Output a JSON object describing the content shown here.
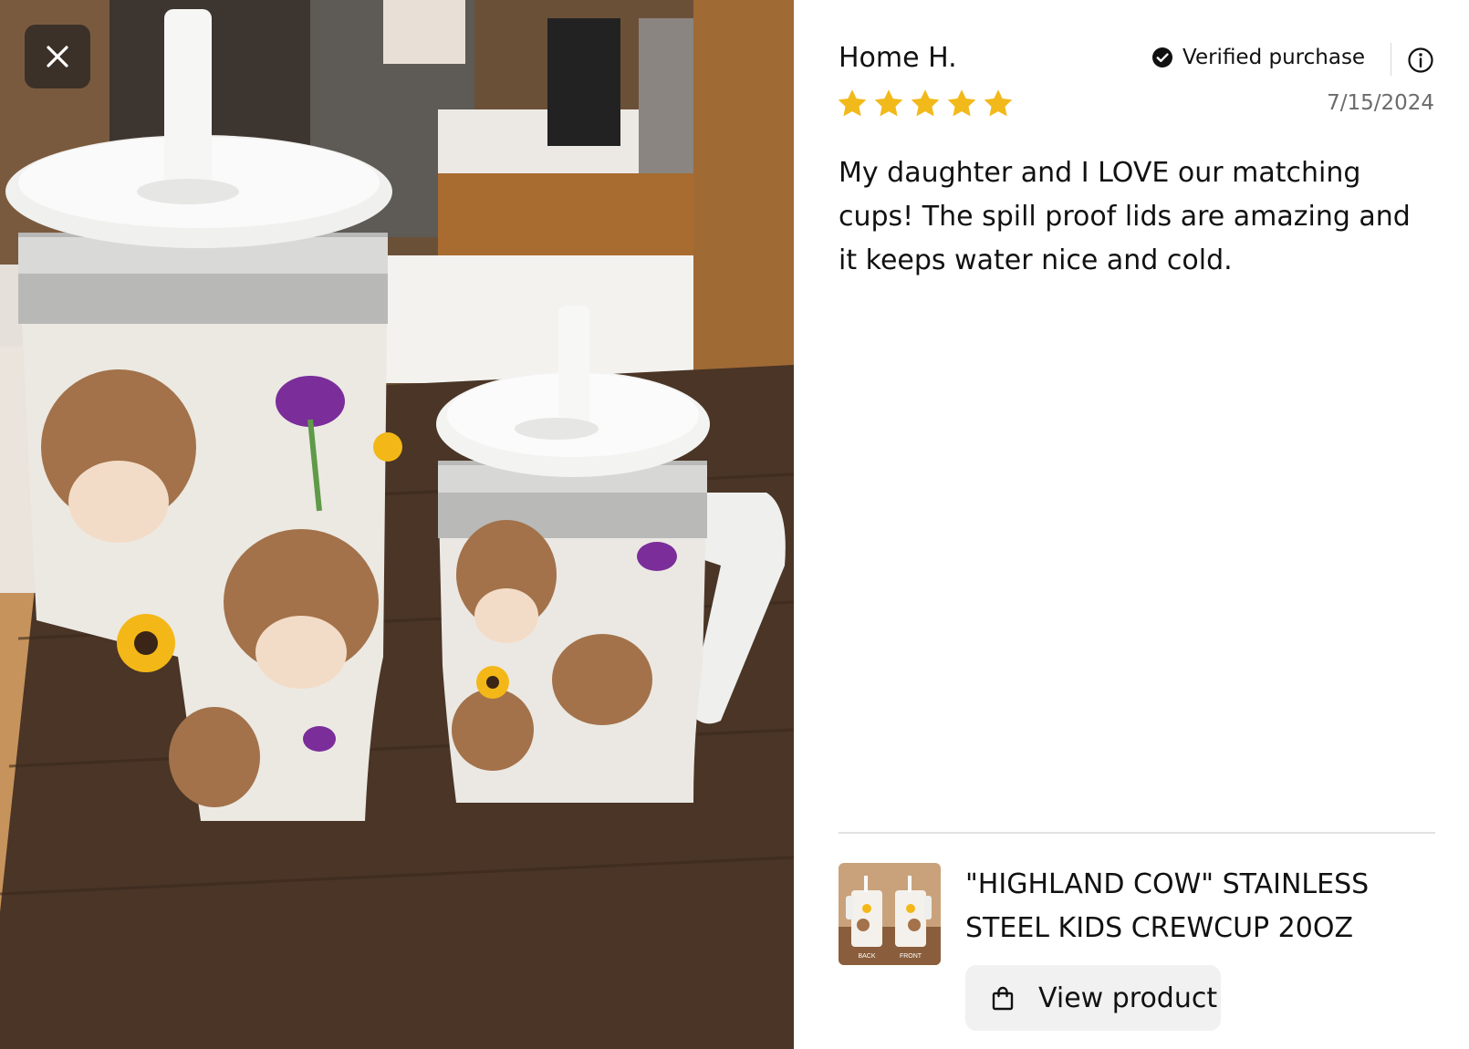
{
  "modal": {
    "close_icon": "close-icon"
  },
  "photo": {
    "description_icon": "review-photo"
  },
  "review": {
    "reviewer_name": "Home H.",
    "verified_label": "Verified purchase",
    "verified_icon": "check-circle-icon",
    "info_icon": "info-icon",
    "rating": 5,
    "rating_max": 5,
    "star_color": "#F2B91B",
    "date": "7/15/2024",
    "body": "My daughter and I LOVE our matching cups! The spill proof lids are amazing and it keeps water nice and cold."
  },
  "product": {
    "title": "\"HIGHLAND COW\" STAINLESS STEEL KIDS CREWCUP 20OZ",
    "thumb_labels": [
      "BACK",
      "FRONT"
    ],
    "view_label": "View product",
    "view_icon": "shopping-bag-icon"
  }
}
